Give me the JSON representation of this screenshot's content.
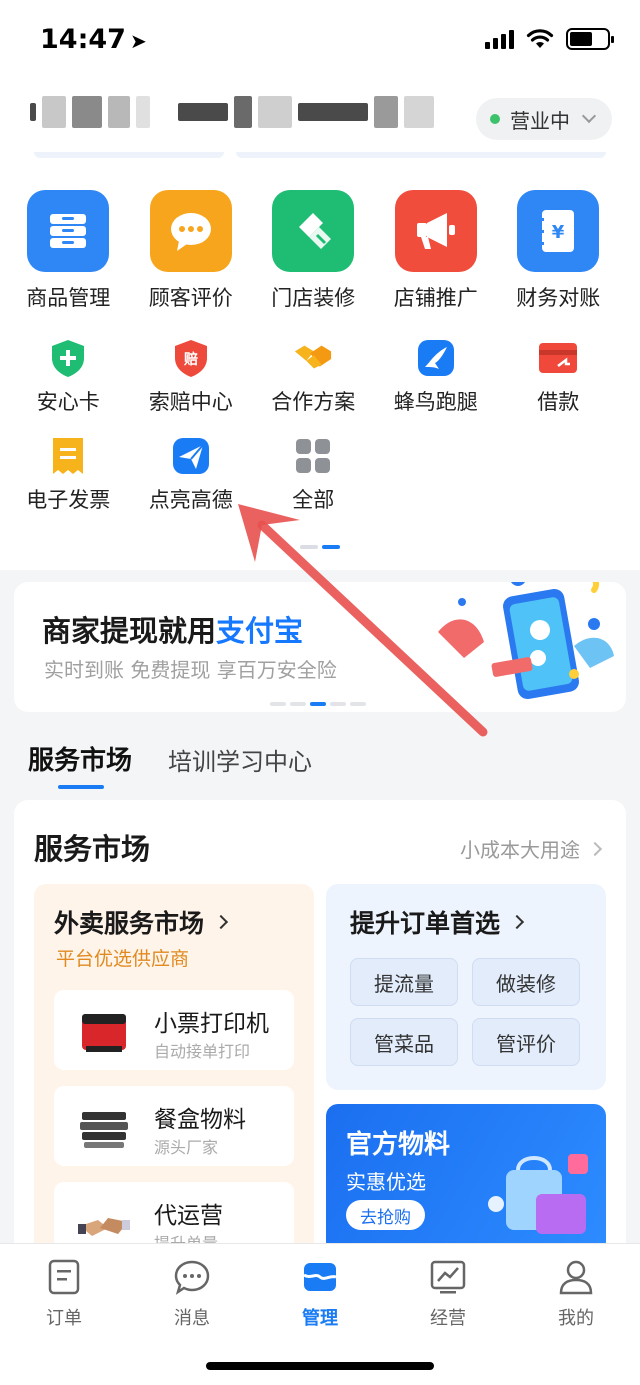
{
  "status_bar": {
    "time": "14:47"
  },
  "header": {
    "business_status": "营业中"
  },
  "colors": {
    "accent": "#1a7cf5",
    "open_dot": "#3cc26b",
    "annotation": "#e8514f"
  },
  "main_tools": [
    {
      "label": "商品管理",
      "icon": "product-icon",
      "color": "#2f86f5"
    },
    {
      "label": "顾客评价",
      "icon": "chat-icon",
      "color": "#f7a51c"
    },
    {
      "label": "门店装修",
      "icon": "brush-icon",
      "color": "#1fbd73"
    },
    {
      "label": "店铺推广",
      "icon": "megaphone-icon",
      "color": "#f04d3c"
    },
    {
      "label": "财务对账",
      "icon": "finance-icon",
      "color": "#2f86f5"
    }
  ],
  "secondary_tools": [
    {
      "label": "安心卡",
      "icon": "shield-icon"
    },
    {
      "label": "索赔中心",
      "icon": "claim-icon"
    },
    {
      "label": "合作方案",
      "icon": "handshake-icon"
    },
    {
      "label": "蜂鸟跑腿",
      "icon": "bird-icon"
    },
    {
      "label": "借款",
      "icon": "loan-card-icon"
    },
    {
      "label": "电子发票",
      "icon": "invoice-icon"
    },
    {
      "label": "点亮高德",
      "icon": "amap-icon"
    },
    {
      "label": "全部",
      "icon": "grid-icon"
    }
  ],
  "banner": {
    "title_prefix": "商家提现就用",
    "title_highlight": "支付宝",
    "subtitle": "实时到账 免费提现 享百万安全险"
  },
  "tabs": [
    {
      "label": "服务市场",
      "active": true
    },
    {
      "label": "培训学习中心",
      "active": false
    }
  ],
  "service_market": {
    "title": "服务市场",
    "more_text": "小成本大用途",
    "waimai": {
      "title": "外卖服务市场",
      "subtitle": "平台优选供应商",
      "products": [
        {
          "name": "小票打印机",
          "desc": "自动接单打印"
        },
        {
          "name": "餐盒物料",
          "desc": "源头厂家"
        },
        {
          "name": "代运营",
          "desc": "提升单量"
        }
      ]
    },
    "tisheng": {
      "title": "提升订单首选",
      "chips": [
        "提流量",
        "做装修",
        "管菜品",
        "管评价"
      ]
    },
    "guanfang": {
      "title": "官方物料",
      "subtitle": "实惠优选",
      "button": "去抢购"
    }
  },
  "bottom_nav": [
    {
      "label": "订单",
      "icon": "order-icon",
      "active": false
    },
    {
      "label": "消息",
      "icon": "message-icon",
      "active": false
    },
    {
      "label": "管理",
      "icon": "manage-icon",
      "active": true
    },
    {
      "label": "经营",
      "icon": "chart-icon",
      "active": false
    },
    {
      "label": "我的",
      "icon": "profile-icon",
      "active": false
    }
  ]
}
